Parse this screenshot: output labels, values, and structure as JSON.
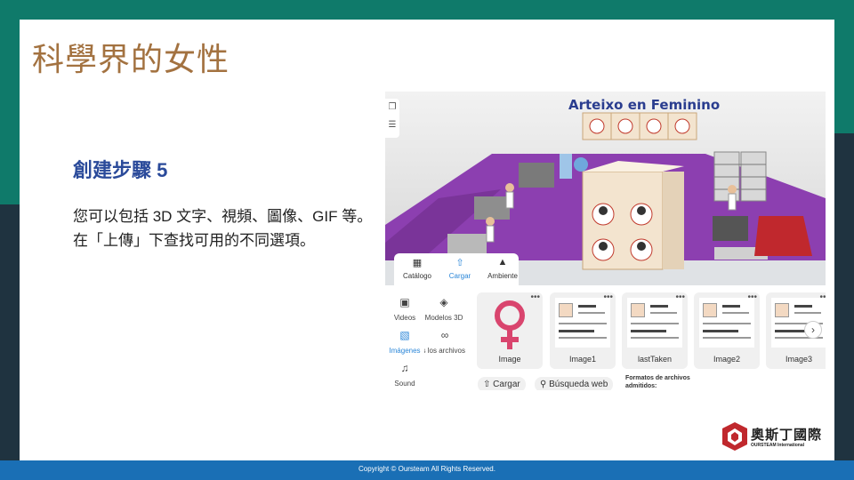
{
  "slide": {
    "title": "科學界的女性",
    "step_heading": "創建步驟 5",
    "step_body": "您可以包括 3D 文字、視頻、圖像、GIF 等。在「上傳」下查找可用的不同選項。"
  },
  "footer": {
    "copyright": "Copyright © Oursteam All Rights Reserved."
  },
  "logo": {
    "name": "奧斯丁國際",
    "sub": "OURSTEAM International"
  },
  "screenshot": {
    "scene_title": "Arteixo en Feminino",
    "tabs": [
      {
        "label": "Catálogo",
        "icon": "grid-icon",
        "active": false
      },
      {
        "label": "Cargar",
        "icon": "upload-icon",
        "active": true
      },
      {
        "label": "Ambiente",
        "icon": "landscape-icon",
        "active": false
      }
    ],
    "categories": [
      {
        "label": "Videos",
        "icon": "video-icon"
      },
      {
        "label": "Modelos 3D",
        "icon": "cube-icon"
      },
      {
        "label": "Imágenes",
        "icon": "image-icon",
        "active": true
      },
      {
        "label": "Todos los archivos",
        "icon": "files-icon"
      },
      {
        "label": "Sound",
        "icon": "music-icon"
      }
    ],
    "cards": [
      {
        "label": "Image",
        "kind": "venus"
      },
      {
        "label": "Image1",
        "kind": "doc"
      },
      {
        "label": "lastTaken",
        "kind": "doc"
      },
      {
        "label": "Image2",
        "kind": "doc"
      },
      {
        "label": "Image3",
        "kind": "doc"
      }
    ],
    "upload_button": "Cargar",
    "search_button": "Búsqueda web",
    "formats_label": "Formatos de archivos admitidos:",
    "colors": {
      "accent": "#2a86d8",
      "floor": "#8c3fb0",
      "venus": "#d9456e"
    }
  }
}
